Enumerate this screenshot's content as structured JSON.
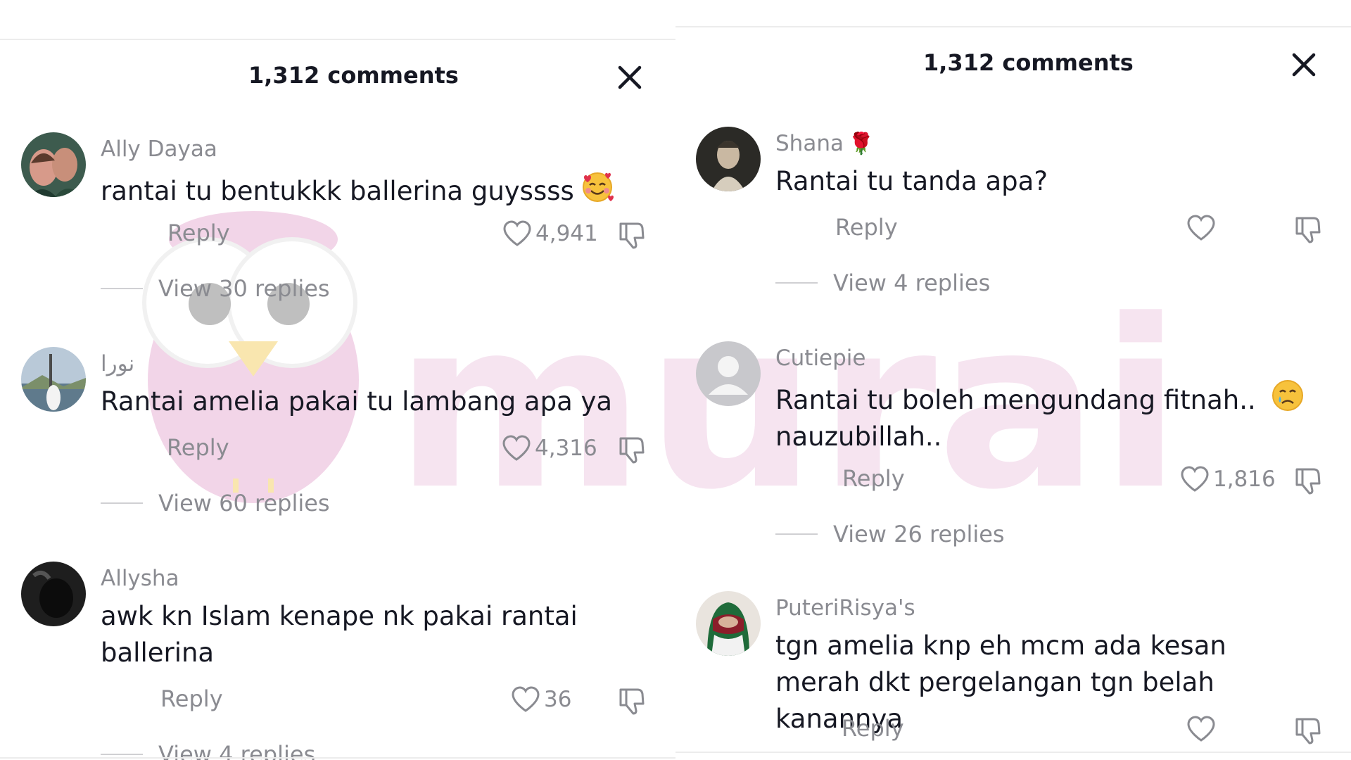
{
  "left_panel": {
    "title": "1,312 comments",
    "comments": [
      {
        "username": "Ally Dayaa",
        "text": "rantai tu bentukkk ballerina guyssss",
        "emoji": "smiling-face-with-hearts-emoji",
        "reply_label": "Reply",
        "likes": "4,941",
        "view_replies": "View 30 replies"
      },
      {
        "username": "نورا",
        "text": "Rantai amelia pakai tu lambang apa ya",
        "reply_label": "Reply",
        "likes": "4,316",
        "view_replies": "View 60 replies"
      },
      {
        "username": "Allysha",
        "text": "awk kn Islam kenape nk pakai rantai ballerina",
        "reply_label": "Reply",
        "likes": "36",
        "view_replies": "View 4 replies"
      }
    ]
  },
  "right_panel": {
    "title": "1,312 comments",
    "comments": [
      {
        "username": "Shana",
        "username_emoji": "🌹",
        "text": "Rantai tu tanda apa?",
        "reply_label": "Reply",
        "likes": "",
        "view_replies": "View 4 replies"
      },
      {
        "username": "Cutiepie",
        "text": "Rantai tu boleh mengundang fitnah..",
        "text_line2": "nauzubillah..",
        "emoji": "crying-face-emoji",
        "reply_label": "Reply",
        "likes": "1,816",
        "view_replies": "View 26 replies"
      },
      {
        "username": "PuteriRisya's",
        "text": "tgn amelia knp eh mcm ada kesan merah dkt pergelangan tgn belah kanannya",
        "reply_label": "Reply",
        "likes": ""
      }
    ]
  },
  "watermark": {
    "text": "murai",
    "color": "#f3dcec"
  },
  "colors": {
    "text": "#161823",
    "secondary": "#8a8b91",
    "divider": "#ececec"
  }
}
